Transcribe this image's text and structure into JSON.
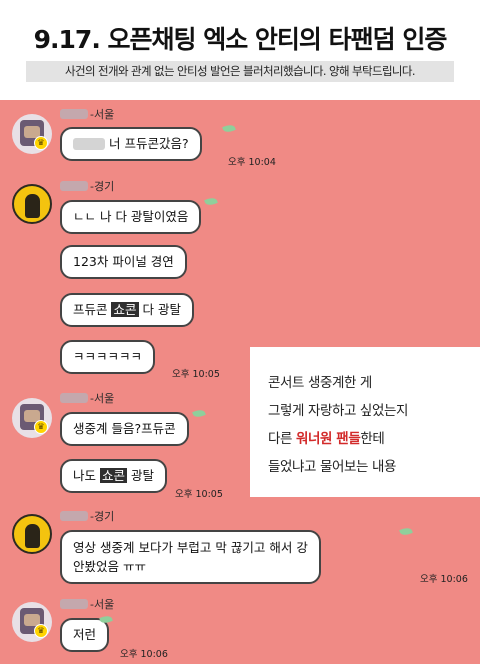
{
  "header": {
    "title": "9.17. 오픈채팅 엑소 안티의 타팬덤 인증",
    "subtitle": "사건의 전개와 관계 없는 안티성 발언은 블러처리했습니다. 양해 부탁드립니다."
  },
  "messages": [
    {
      "sender": "-서울",
      "text": "너 프듀콘갔음?",
      "time": "오후 10:04"
    },
    {
      "sender": "-경기",
      "lines": [
        "ㄴㄴ 나 다 광탈이였음",
        "123차 파이널 경연"
      ],
      "line3_pre": "프듀콘 ",
      "line3_hl": "쇼콘",
      "line3_post": " 다 광탈",
      "line4": "ㅋㅋㅋㅋㅋㅋ",
      "time": "오후 10:05"
    },
    {
      "sender": "-서울",
      "text": "생중계 들음?프듀콘",
      "line2_pre": "나도 ",
      "line2_hl": "쇼콘",
      "line2_post": " 광탈",
      "time": "오후 10:05"
    },
    {
      "sender": "-경기",
      "line1": "영상 생중계 보다가 부럽고 막 끊기고 해서 강",
      "line2": "안봤었음 ㅠㅠ",
      "time": "오후 10:06"
    },
    {
      "sender": "-서울",
      "text": "저런",
      "time": "오후 10:06"
    }
  ],
  "note": {
    "line1": "콘서트 생중계한 게",
    "line2": "그렇게 자랑하고 싶었는지",
    "line3_pre": "다른 ",
    "line3_red": "워너원 팬들",
    "line3_post": "한테",
    "line4": "들었냐고 물어보는 내용"
  }
}
